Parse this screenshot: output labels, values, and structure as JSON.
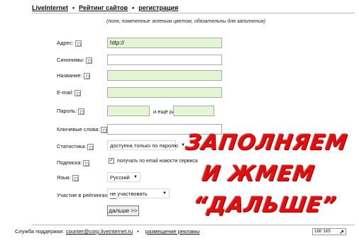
{
  "breadcrumb": {
    "item1": "LiveInternet",
    "item2": "Рейтинг сайтов",
    "item3": "регистрация",
    "separator": "•"
  },
  "hint": "(поля, помеченные зеленым цветом, обязательны для заполнения)",
  "form": {
    "address": {
      "label": "Адрес:",
      "value": "http://"
    },
    "synonyms": {
      "label": "Синонимы:",
      "value": ""
    },
    "title": {
      "label": "Название:",
      "value": ""
    },
    "email": {
      "label": "E-mail:",
      "value": ""
    },
    "password": {
      "label": "Пароль:",
      "value": "",
      "again_label": "и ещё раз:",
      "again_value": ""
    },
    "keywords": {
      "label": "Ключевые слова:",
      "value": ""
    },
    "stats": {
      "label": "Статистика:",
      "selected": "доступна только по паролю"
    },
    "subscribe": {
      "label": "Подписка:",
      "checked_mark": "✓",
      "text": "получать по email новости сервиса"
    },
    "language": {
      "label": "Язык:",
      "selected": "Русский"
    },
    "ratings": {
      "label": "Участие в рейтингах:",
      "selected": "не участвовать"
    },
    "next_button": "дальше >>"
  },
  "overlay": {
    "line1": "ЗАПОЛНЯЕМ",
    "line2": "И ЖМЕМ",
    "line3": "“ДАЛЬШЕ”",
    "color": "#e01010"
  },
  "footer": {
    "support_label": "Служба поддержки:",
    "email": "counter@corp.liveinternet.ru",
    "separator": "•",
    "ads_link": "размещение рекламы"
  },
  "counter": {
    "value": "188 '165",
    "arrow": "↗"
  },
  "colors": {
    "required_field_bg": "#e4f5d4"
  }
}
